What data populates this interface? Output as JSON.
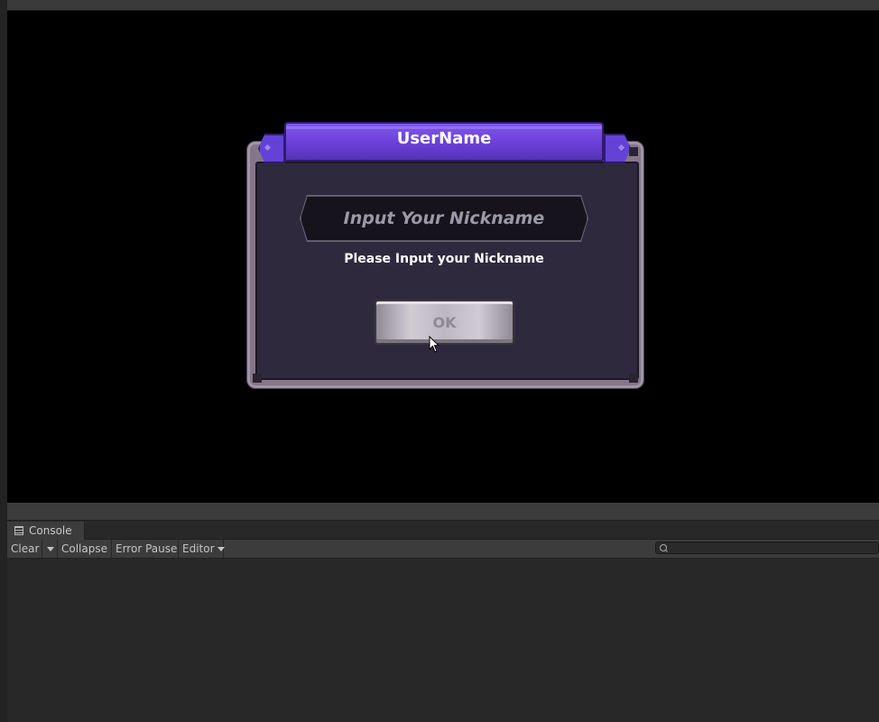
{
  "dialog": {
    "title": "UserName",
    "input_placeholder": "Input Your Nickname",
    "hint": "Please Input your Nickname",
    "ok_label": "OK"
  },
  "console": {
    "tab_label": "Console",
    "toolbar": {
      "clear": "Clear",
      "collapse": "Collapse",
      "error_pause": "Error Pause",
      "editor": "Editor"
    },
    "search_value": ""
  }
}
